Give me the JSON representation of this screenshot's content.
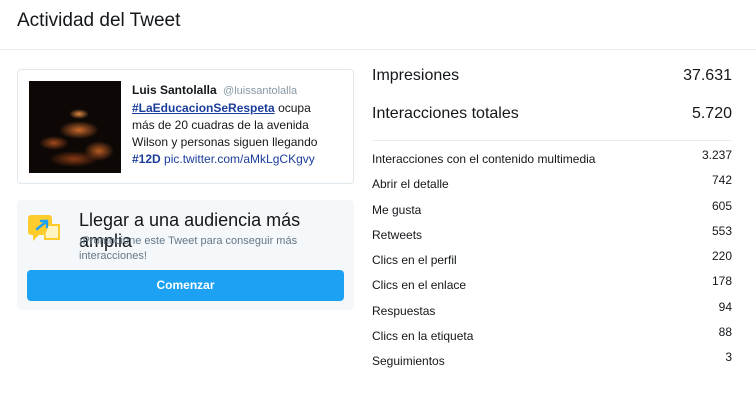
{
  "header": {
    "title": "Actividad del Tweet"
  },
  "tweet": {
    "author": "Luis Santolalla",
    "handle": "@luissantolalla",
    "hashtag": "#LaEducacionSeRespeta",
    "text_lines": [
      "ocupa",
      "más de 20 cuadras de la avenida",
      "Wilson y personas siguen llegando"
    ],
    "hashtag2": "#12D",
    "link": "pic.twitter.com/aMkLgCKgvy"
  },
  "promo": {
    "title": "Llegar a una audiencia más amplia",
    "subtitle": "¡Promocione este Tweet para conseguir más interacciones!",
    "button": "Comenzar",
    "icon": "megaphone-icon",
    "icon_color": "#ffcc2e",
    "button_color": "#1da1f2"
  },
  "stats": {
    "primary": [
      {
        "label": "Impresiones",
        "value": "37.631"
      },
      {
        "label": "Interacciones totales",
        "value": "5.720"
      }
    ],
    "details": [
      {
        "label": "Interacciones con el contenido multimedia",
        "value": "3.237"
      },
      {
        "label": "Abrir el detalle",
        "value": "742"
      },
      {
        "label": "Me gusta",
        "value": "605"
      },
      {
        "label": "Retweets",
        "value": "553"
      },
      {
        "label": "Clics en el perfil",
        "value": "220"
      },
      {
        "label": "Clics en el enlace",
        "value": "178"
      },
      {
        "label": "Respuestas",
        "value": "94"
      },
      {
        "label": "Clics en la etiqueta",
        "value": "88"
      },
      {
        "label": "Seguimientos",
        "value": "3"
      }
    ]
  }
}
